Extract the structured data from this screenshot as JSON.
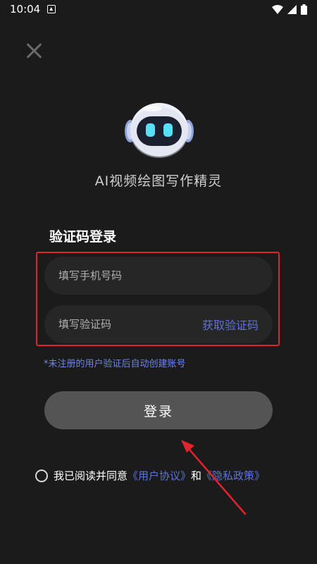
{
  "status_bar": {
    "time": "10:04"
  },
  "app": {
    "title": "AI视频绘图写作精灵"
  },
  "login": {
    "section_title": "验证码登录",
    "phone_placeholder": "填写手机号码",
    "code_placeholder": "填写验证码",
    "get_code_label": "获取验证码",
    "hint": "*未注册的用户验证后自动创建账号",
    "login_button": "登录"
  },
  "agreement": {
    "prefix": "我已阅读并同意",
    "user_agreement": "《用户协议》",
    "and": "和",
    "privacy_policy": "《隐私政策》"
  },
  "colors": {
    "background": "#1b1b1b",
    "accent_link": "#5b73d8",
    "highlight_frame": "#e0232c"
  }
}
